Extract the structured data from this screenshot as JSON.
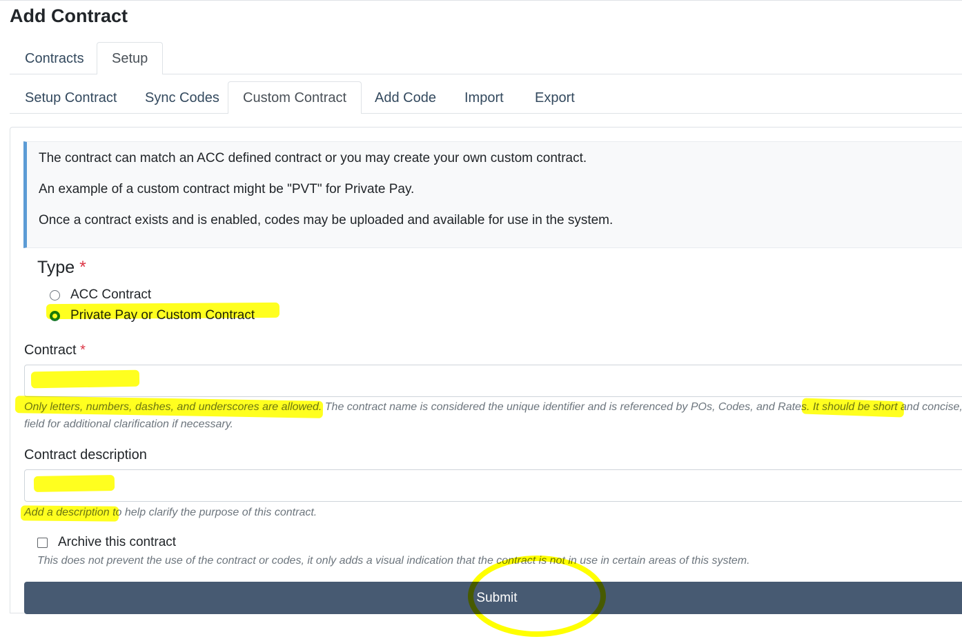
{
  "page": {
    "title": "Add Contract"
  },
  "tabs_primary": [
    {
      "label": "Contracts",
      "active": false
    },
    {
      "label": "Setup",
      "active": true
    }
  ],
  "tabs_secondary": [
    {
      "label": "Setup Contract",
      "active": false
    },
    {
      "label": "Sync Codes",
      "active": false
    },
    {
      "label": "Custom Contract",
      "active": true
    },
    {
      "label": "Add Code",
      "active": false
    },
    {
      "label": "Import",
      "active": false
    },
    {
      "label": "Export",
      "active": false
    }
  ],
  "info": {
    "line1": "The contract can match an ACC defined contract or you may create your own custom contract.",
    "line2": "An example of a custom contract might be \"PVT\" for Private Pay.",
    "line3": "Once a contract exists and is enabled, codes may be uploaded and available for use in the system."
  },
  "form": {
    "type_label": "Type",
    "required_mark": "*",
    "type_options": [
      {
        "label": "ACC Contract",
        "checked": false
      },
      {
        "label": "Private Pay or Custom Contract",
        "checked": true
      }
    ],
    "contract_label": "Contract",
    "contract_value": "",
    "contract_help_line1": "Only letters, numbers, dashes, and underscores are allowed. The contract name is considered the unique identifier and is referenced by POs, Codes, and Rates. It should be short and concise, u",
    "contract_help_line2": "field for additional clarification if necessary.",
    "description_label": "Contract description",
    "description_value": "",
    "description_help": "Add a description to help clarify the purpose of this contract.",
    "archive_label": "Archive this contract",
    "archive_checked": false,
    "archive_help": "This does not prevent the use of the contract or codes, it only adds a visual indication that the contract is not in use in certain areas of this system.",
    "submit_label": "Submit"
  },
  "colors": {
    "accent": "#5b9bd5",
    "submit_bg": "#475a72",
    "required": "#dc3545",
    "highlight": "#ffff00",
    "radio_checked": "#1b7a2c"
  }
}
